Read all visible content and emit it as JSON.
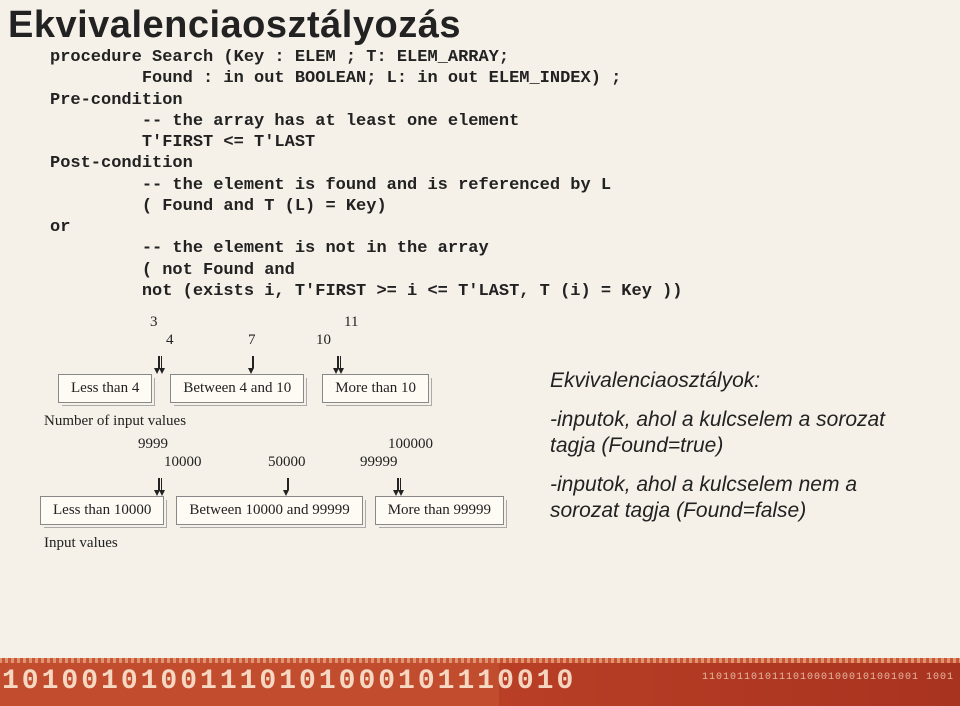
{
  "title": "Ekvivalenciaosztályozás",
  "code": "procedure Search (Key : ELEM ; T: ELEM_ARRAY;\n         Found : in out BOOLEAN; L: in out ELEM_INDEX) ;\nPre-condition\n         -- the array has at least one element\n         T'FIRST <= T'LAST\nPost-condition\n         -- the element is found and is referenced by L\n         ( Found and T (L) = Key)\nor\n         -- the element is not in the array\n         ( not Found and\n         not (exists i, T'FIRST >= i <= T'LAST, T (i) = Key ))",
  "top_nums": {
    "n3": "3",
    "n4": "4",
    "n7": "7",
    "n10": "10",
    "n11": "11"
  },
  "box_row1": {
    "a": "Less than 4",
    "b": "Between 4 and 10",
    "c": "More than 10"
  },
  "cap1": "Number of input values",
  "mid_nums": {
    "n9999": "9999",
    "n10000": "10000",
    "n50000": "50000",
    "n99999": "99999",
    "n100000": "100000"
  },
  "box_row2": {
    "a": "Less than 10000",
    "b": "Between 10000 and 99999",
    "c": "More than 99999"
  },
  "cap2": "Input values",
  "right": {
    "heading": "Ekvivalenciaosztályok:",
    "p1": "-inputok, ahol a kulcselem a sorozat tagja (Found=true)",
    "p2": "-inputok, ahol a kulcselem nem a sorozat tagja (Found=false)"
  },
  "footer": {
    "big": "10100101001110101000101110010",
    "small": "1101011010111010001000101001001   1001"
  }
}
